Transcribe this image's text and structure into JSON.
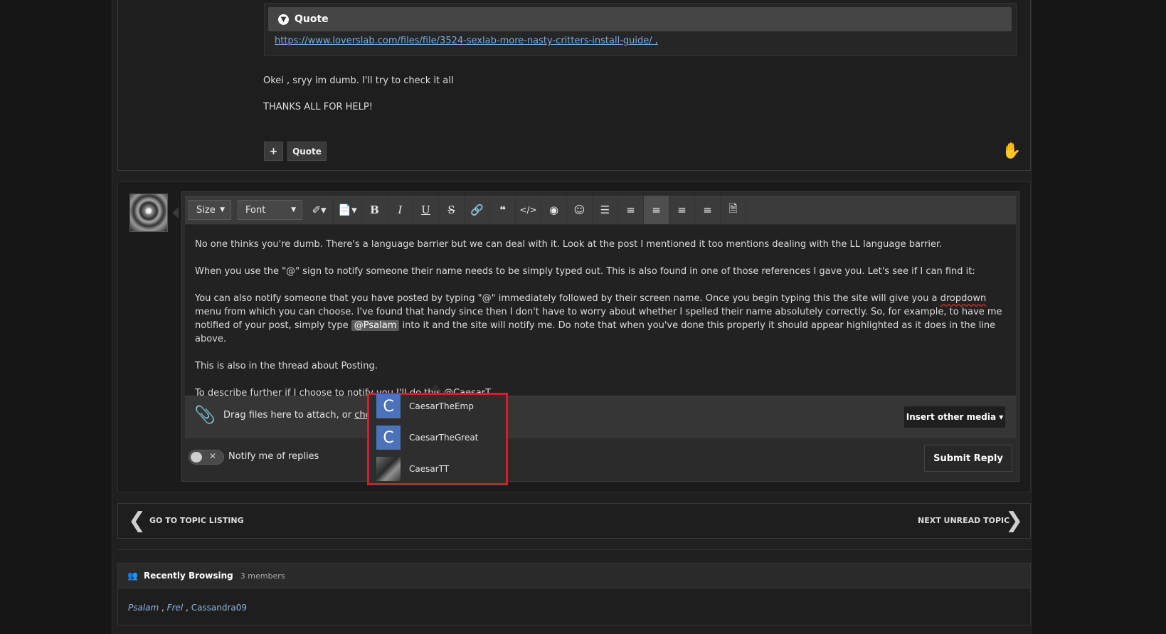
{
  "post": {
    "quote_label": "Quote",
    "quote_link": "https://www.loverslab.com/files/file/3524-sexlab-more-nasty-critters-install-guide/",
    "quote_link_trail": " .",
    "line1": "Okei , sryy im dumb. I'll try to check it all",
    "line2": "THANKS ALL FOR HELP!",
    "plus_label": "+",
    "quote_button": "Quote"
  },
  "toolbar": {
    "size_label": "Size",
    "font_label": "Font"
  },
  "editor": {
    "p1": "No one thinks you're dumb. There's a language barrier but we can deal with it. Look at the post I mentioned it too mentions dealing with the LL language barrier.",
    "p2": "When you use the \"@\" sign to notify someone their name needs to be simply typed out. This is also found in one of those references I gave you. Let's see if I can find it:",
    "p3a": "You can also notify someone that you have posted by typing \"@\" immediately followed by their screen name. Once you begin typing this the site will give you a",
    "p3b": "dropdown",
    "p3c": "menu from which you can choose. I've found that handy since then I don't have to worry about whether I spelled their name absolutely correctly. So, for example, to have me notified of your post, simply type",
    "p3d": "@Psalam",
    "p3e": "into it and the site will notify me. Do note that when you've done this properly it should appear highlighted as it does in the line above.",
    "p4": "This is also in the thread about Posting.",
    "p5a": "To describe further if I choose to notify you I'll do this",
    "p5b": "@CaesarT"
  },
  "attach": {
    "text": "Drag files here to attach, or",
    "choose": "choose",
    "media_button": "Insert other media ▾"
  },
  "notify_label": "Notify me of replies",
  "submit_label": "Submit Reply",
  "mention_dropdown": [
    {
      "letter": "C",
      "name": "CaesarTheEmp"
    },
    {
      "letter": "C",
      "name": "CaesarTheGreat"
    },
    {
      "letter": "",
      "name": "CaesarTT"
    }
  ],
  "nav": {
    "prev": "GO TO TOPIC LISTING",
    "next": "NEXT UNREAD TOPIC"
  },
  "recently": {
    "title": "Recently Browsing",
    "count": "3 members",
    "users": [
      "Psalam",
      "Frel",
      "Cassandra09"
    ]
  },
  "colors": {
    "accent_link": "#7fa9d9",
    "highlight_border": "#d41e2a",
    "avatar_blue": "#4c72b9"
  }
}
